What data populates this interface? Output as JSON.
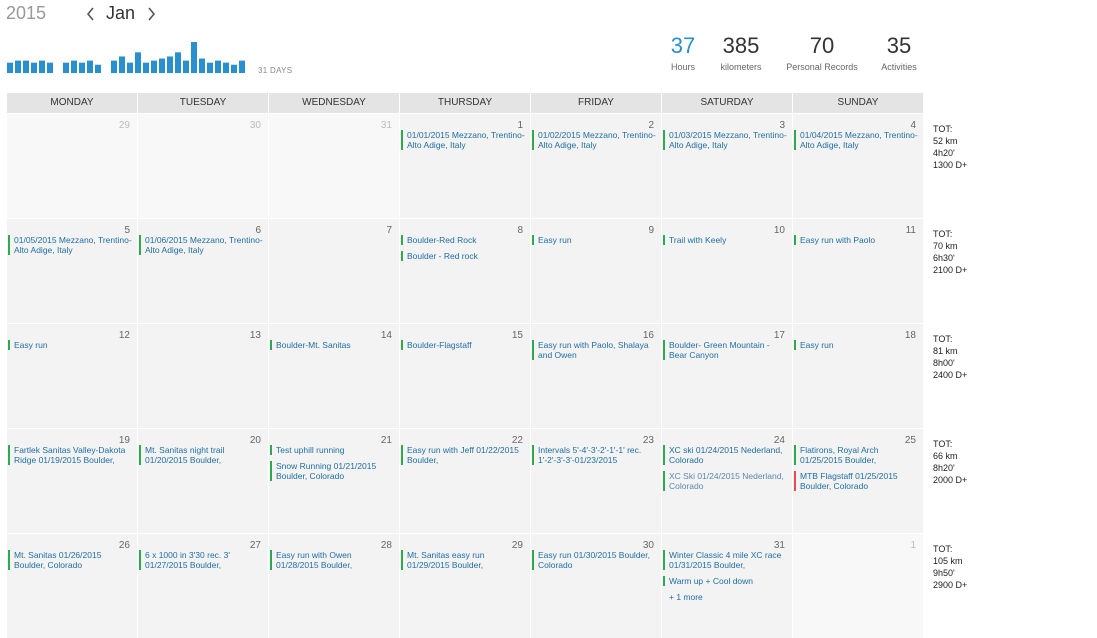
{
  "header": {
    "year": "2015",
    "month": "Jan",
    "days_label": "31 DAYS"
  },
  "sparkline": {
    "values": [
      10,
      12,
      12,
      10,
      12,
      10,
      0,
      10,
      12,
      10,
      12,
      8,
      0,
      12,
      16,
      10,
      20,
      10,
      12,
      14,
      16,
      20,
      12,
      30,
      14,
      10,
      12,
      10,
      8,
      12
    ]
  },
  "stats": [
    {
      "value": "37",
      "label": "Hours"
    },
    {
      "value": "385",
      "label": "kilometers"
    },
    {
      "value": "70",
      "label": "Personal Records"
    },
    {
      "value": "35",
      "label": "Activities"
    }
  ],
  "weekdays": [
    "MONDAY",
    "TUESDAY",
    "WEDNESDAY",
    "THURSDAY",
    "FRIDAY",
    "SATURDAY",
    "SUNDAY"
  ],
  "weeks": [
    {
      "days": [
        {
          "n": "29",
          "other": true,
          "events": []
        },
        {
          "n": "30",
          "other": true,
          "events": []
        },
        {
          "n": "31",
          "other": true,
          "events": []
        },
        {
          "n": "1",
          "events": [
            {
              "t": "01/01/2015 Mezzano, Trentino-Alto Adige, Italy"
            }
          ]
        },
        {
          "n": "2",
          "events": [
            {
              "t": "01/02/2015 Mezzano, Trentino-Alto Adige, Italy"
            }
          ]
        },
        {
          "n": "3",
          "events": [
            {
              "t": "01/03/2015 Mezzano, Trentino-Alto Adige, Italy"
            }
          ]
        },
        {
          "n": "4",
          "events": [
            {
              "t": "01/04/2015 Mezzano, Trentino-Alto Adige, Italy"
            }
          ]
        }
      ],
      "tot": [
        "TOT:",
        "52 km",
        "4h20'",
        "1300 D+"
      ]
    },
    {
      "days": [
        {
          "n": "5",
          "events": [
            {
              "t": "01/05/2015 Mezzano, Trentino-Alto Adige, Italy"
            }
          ]
        },
        {
          "n": "6",
          "events": [
            {
              "t": "01/06/2015 Mezzano, Trentino-Alto Adige, Italy"
            }
          ]
        },
        {
          "n": "7",
          "events": []
        },
        {
          "n": "8",
          "events": [
            {
              "t": "Boulder-Red Rock"
            },
            {
              "t": "Boulder - Red rock"
            }
          ]
        },
        {
          "n": "9",
          "events": [
            {
              "t": "Easy run"
            }
          ]
        },
        {
          "n": "10",
          "events": [
            {
              "t": "Trail with Keely"
            }
          ]
        },
        {
          "n": "11",
          "events": [
            {
              "t": "Easy run with Paolo"
            }
          ]
        }
      ],
      "tot": [
        "TOT:",
        "70 km",
        "6h30'",
        "2100 D+"
      ]
    },
    {
      "days": [
        {
          "n": "12",
          "events": [
            {
              "t": "Easy run"
            }
          ]
        },
        {
          "n": "13",
          "events": []
        },
        {
          "n": "14",
          "events": [
            {
              "t": "Boulder-Mt. Sanitas"
            }
          ]
        },
        {
          "n": "15",
          "events": [
            {
              "t": "Boulder-Flagstaff"
            }
          ]
        },
        {
          "n": "16",
          "events": [
            {
              "t": "Easy run with Paolo, Shalaya and Owen"
            }
          ]
        },
        {
          "n": "17",
          "events": [
            {
              "t": "Boulder- Green Mountain - Bear Canyon"
            }
          ]
        },
        {
          "n": "18",
          "events": [
            {
              "t": "Easy run"
            }
          ]
        }
      ],
      "tot": [
        "TOT:",
        "81 km",
        "8h00'",
        "2400 D+"
      ]
    },
    {
      "days": [
        {
          "n": "19",
          "events": [
            {
              "t": "Fartlek Sanitas Valley-Dakota Ridge 01/19/2015 Boulder,"
            }
          ]
        },
        {
          "n": "20",
          "events": [
            {
              "t": "Mt. Sanitas night trail 01/20/2015 Boulder,"
            }
          ]
        },
        {
          "n": "21",
          "events": [
            {
              "t": "Test uphill running"
            },
            {
              "t": "Snow Running 01/21/2015 Boulder, Colorado"
            }
          ]
        },
        {
          "n": "22",
          "events": [
            {
              "t": "Easy run with Jeff 01/22/2015 Boulder,"
            }
          ]
        },
        {
          "n": "23",
          "events": [
            {
              "t": "Intervals 5'-4'-3'-2'-1'-1' rec. 1'-2'-3'-3'-01/23/2015"
            }
          ]
        },
        {
          "n": "24",
          "events": [
            {
              "t": "XC ski 01/24/2015 Nederland, Colorado"
            },
            {
              "t": "XC Ski 01/24/2015 Nederland, Colorado",
              "dim": true
            }
          ]
        },
        {
          "n": "25",
          "events": [
            {
              "t": "Flatirons, Royal Arch 01/25/2015 Boulder,"
            },
            {
              "t": "MTB Flagstaff 01/25/2015 Boulder, Colorado",
              "red": true
            }
          ]
        }
      ],
      "tot": [
        "TOT:",
        "66 km",
        "8h20'",
        "2000 D+"
      ]
    },
    {
      "days": [
        {
          "n": "26",
          "events": [
            {
              "t": "Mt. Sanitas 01/26/2015 Boulder, Colorado"
            }
          ]
        },
        {
          "n": "27",
          "events": [
            {
              "t": "6 x 1000 in 3'30 rec. 3' 01/27/2015 Boulder,"
            }
          ]
        },
        {
          "n": "28",
          "events": [
            {
              "t": "Easy run with Owen 01/28/2015 Boulder,"
            }
          ]
        },
        {
          "n": "29",
          "events": [
            {
              "t": "Mt. Sanitas easy run 01/29/2015 Boulder,"
            }
          ]
        },
        {
          "n": "30",
          "events": [
            {
              "t": "Easy run 01/30/2015 Boulder, Colorado"
            }
          ]
        },
        {
          "n": "31",
          "events": [
            {
              "t": "Winter Classic 4 mile XC race 01/31/2015 Boulder,"
            },
            {
              "t": "Warm up + Cool down"
            }
          ],
          "more": "+ 1 more"
        },
        {
          "n": "1",
          "other": true,
          "events": []
        }
      ],
      "tot": [
        "TOT:",
        "105 km",
        "9h50'",
        "2900 D+"
      ]
    }
  ]
}
